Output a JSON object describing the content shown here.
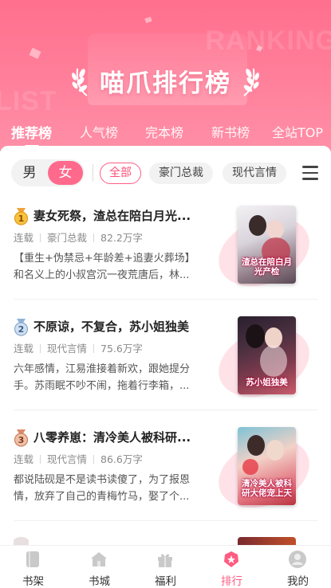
{
  "header": {
    "title": "喵爪排行榜",
    "tabs": [
      {
        "label": "推荐榜",
        "active": true
      },
      {
        "label": "人气榜",
        "active": false
      },
      {
        "label": "完本榜",
        "active": false
      },
      {
        "label": "新书榜",
        "active": false
      },
      {
        "label": "全站TOP",
        "active": false
      }
    ]
  },
  "filters": {
    "gender": {
      "male": "男",
      "female": "女",
      "selected": "女"
    },
    "categories": [
      {
        "label": "全部",
        "active": true
      },
      {
        "label": "豪门总裁",
        "active": false
      },
      {
        "label": "现代言情",
        "active": false
      }
    ]
  },
  "books": [
    {
      "rank": "1",
      "title": "妻女死祭，渣总在陪白月光...",
      "status": "连载",
      "genre": "豪门总裁",
      "words": "82.2万字",
      "desc": "【重生+伪禁忌+年龄差+追妻火葬场】和名义上的小叔宫沉一夜荒唐后，林...",
      "cover_title": "渣总在陪白月光产检"
    },
    {
      "rank": "2",
      "title": "不原谅，不复合，苏小姐独美",
      "status": "连载",
      "genre": "现代言情",
      "words": "75.6万字",
      "desc": "六年感情，江易淮接着新欢，跟她提分手。苏雨眠不吵不闹，拖着行李箱，...",
      "cover_title": "苏小姐独美"
    },
    {
      "rank": "3",
      "title": "八零养崽：清冷美人被科研...",
      "status": "连载",
      "genre": "现代言情",
      "words": "86.6万字",
      "desc": "都说陆砚是不是读书读傻了，为了报恩情，放弃了自己的青梅竹马，娶了个...",
      "cover_title": "清冷美人被科研大佬宠上天"
    }
  ],
  "bottom_nav": [
    {
      "label": "书架",
      "icon": "bookshelf-icon",
      "active": false
    },
    {
      "label": "书城",
      "icon": "bookstore-home-icon",
      "active": false
    },
    {
      "label": "福利",
      "icon": "gift-icon",
      "active": false
    },
    {
      "label": "排行",
      "icon": "ranking-icon",
      "active": true
    },
    {
      "label": "我的",
      "icon": "profile-icon",
      "active": false
    }
  ],
  "colors": {
    "accent": "#ff5c82",
    "header_top": "#ff6f8e",
    "header_bottom": "#ff8fa7"
  }
}
